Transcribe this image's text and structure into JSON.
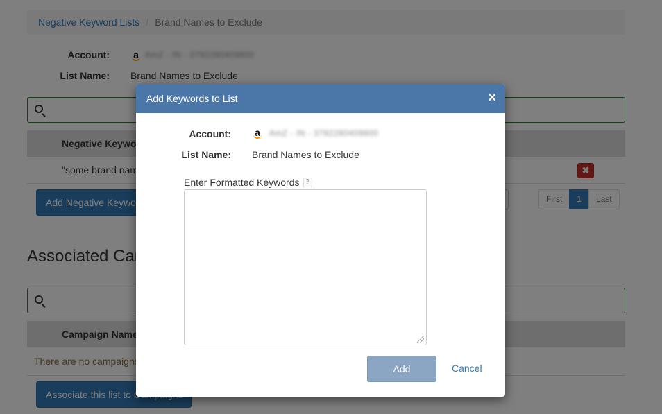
{
  "breadcrumb": {
    "parent": "Negative Keyword Lists",
    "separator": "/",
    "current": "Brand Names to Exclude"
  },
  "details": {
    "account_label": "Account:",
    "account_icon": "amazon-icon",
    "account_value_redacted": "AmZ - IN - 3792280409800",
    "list_name_label": "List Name:",
    "list_name_value": "Brand Names to Exclude"
  },
  "keywords_table": {
    "header": "Negative Keywords",
    "rows": [
      {
        "keyword": "\"some brand name\""
      }
    ],
    "add_button": "Add Negative Keywords",
    "pagination": {
      "first": "First",
      "current": "1",
      "last": "Last"
    }
  },
  "campaigns_section": {
    "title": "Associated Campaigns",
    "header": "Campaign Name",
    "empty_message": "There are no campaigns",
    "associate_button": "Associate this list to Campaigns"
  },
  "modal": {
    "title": "Add Keywords to List",
    "close_glyph": "×",
    "account_label": "Account:",
    "account_icon": "amazon-icon",
    "account_value_redacted": "AmZ - IN - 3792280409800",
    "list_name_label": "List Name:",
    "list_name_value": "Brand Names to Exclude",
    "field_label": "Enter Formatted Keywords",
    "help_glyph": "?",
    "textarea_value": "",
    "add_button": "Add",
    "cancel_link": "Cancel"
  },
  "colors": {
    "modal_header": "#4a77a8",
    "link": "#337ab7",
    "primary_button": "#337ab7",
    "add_button_disabled": "#8aa6c2",
    "delete_button": "#c9302c",
    "warning_text": "#8a6d3b",
    "search_border": "#3c763d"
  }
}
